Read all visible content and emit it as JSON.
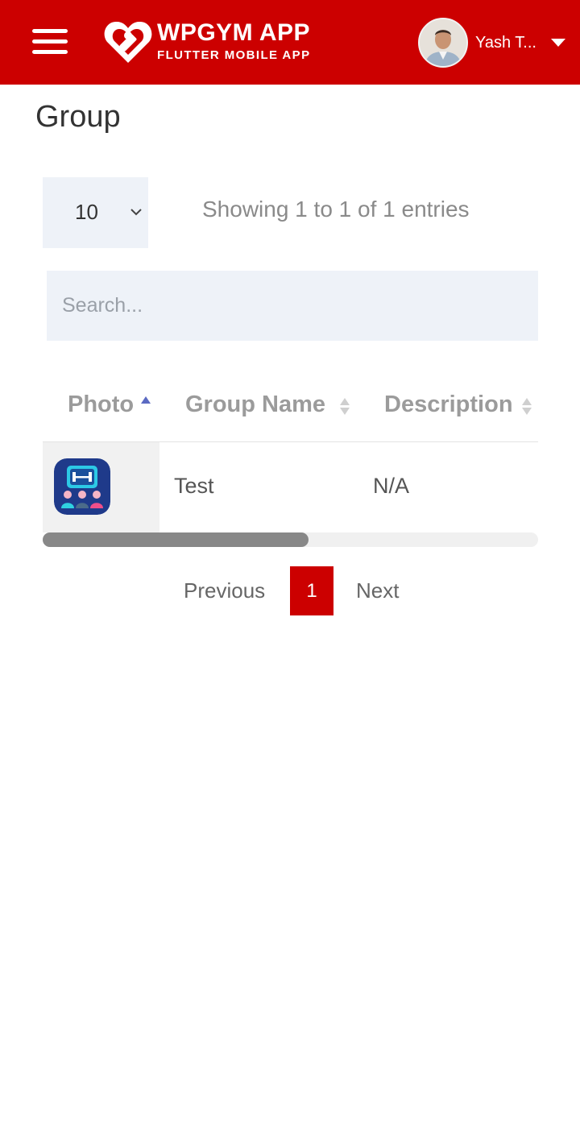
{
  "header": {
    "logo_title": "WPGYM APP",
    "logo_subtitle": "FLUTTER MOBILE APP",
    "user_name": "Yash T...",
    "brand_color": "#cc0000"
  },
  "page": {
    "title": "Group"
  },
  "table_controls": {
    "page_length": "10",
    "entries_info": "Showing 1 to 1 of 1 entries",
    "search_placeholder": "Search..."
  },
  "table": {
    "columns": [
      {
        "label": "Photo",
        "sort": "ascending"
      },
      {
        "label": "Group Name",
        "sort": "none"
      },
      {
        "label": "Description",
        "sort": "none"
      }
    ],
    "rows": [
      {
        "photo_icon": "group-dumbbell-icon",
        "name": "Test",
        "description": "N/A"
      }
    ]
  },
  "pagination": {
    "previous": "Previous",
    "current": "1",
    "next": "Next"
  }
}
